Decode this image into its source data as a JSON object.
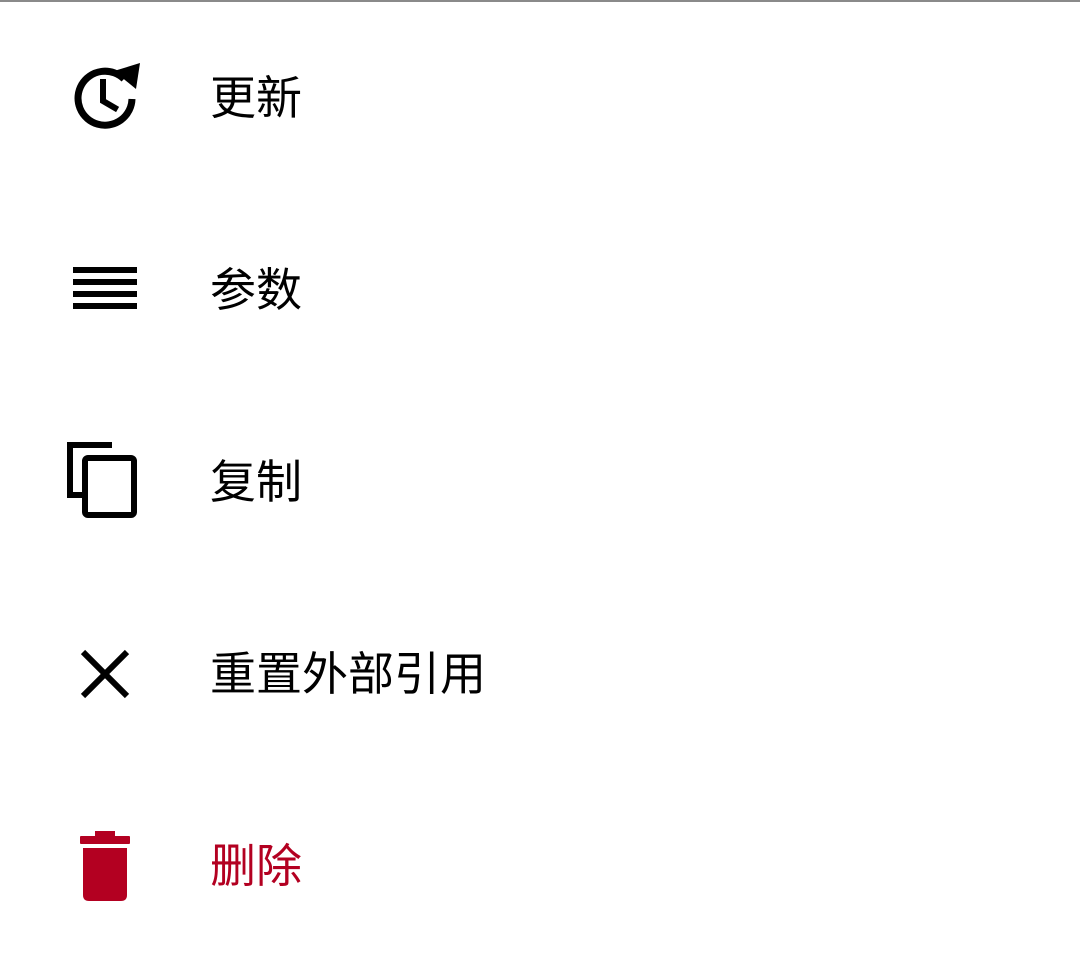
{
  "colors": {
    "text": "#000000",
    "danger": "#b30021",
    "divider": "#8a8a8a",
    "background": "#ffffff"
  },
  "menu": {
    "items": [
      {
        "id": "update",
        "label": "更新",
        "icon": "update-clock-icon"
      },
      {
        "id": "params",
        "label": "参数",
        "icon": "list-lines-icon"
      },
      {
        "id": "copy",
        "label": "复制",
        "icon": "copy-icon"
      },
      {
        "id": "reset-external-ref",
        "label": "重置外部引用",
        "icon": "close-icon"
      },
      {
        "id": "delete",
        "label": "删除",
        "icon": "trash-icon"
      }
    ]
  }
}
